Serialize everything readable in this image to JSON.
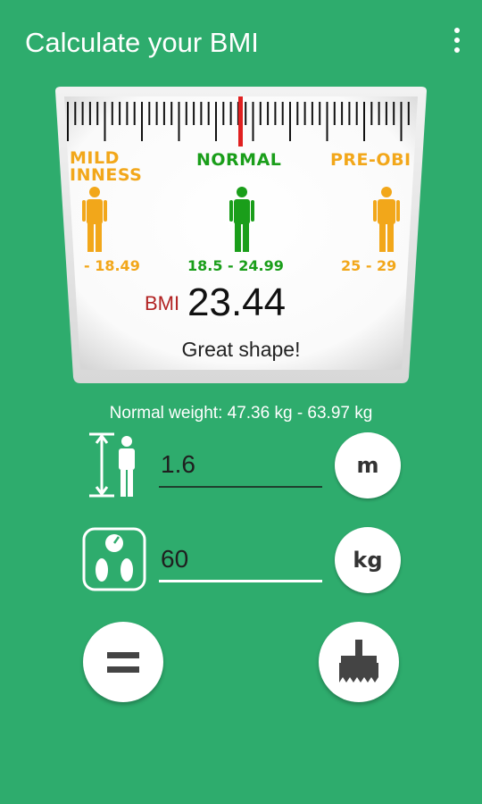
{
  "app_bar": {
    "title": "Calculate your BMI",
    "menu_icon": "overflow-menu-icon"
  },
  "scale": {
    "categories": [
      {
        "label_line1": "MILD",
        "label_line2": "INNESS",
        "range": "- 18.49",
        "color": "#f2a71a"
      },
      {
        "label_line1": "NORMAL",
        "label_line2": "",
        "range": "18.5 - 24.99",
        "color": "#1a9e1a"
      },
      {
        "label_line1": "PRE-OBI",
        "label_line2": "",
        "range": "25 - 29",
        "color": "#f2a71a"
      }
    ],
    "indicator_color": "#e02020",
    "bmi_prefix": "BMI",
    "bmi_value": "23.44",
    "status": "Great shape!"
  },
  "normal_weight": "Normal weight: 47.36 kg - 63.97 kg",
  "height": {
    "value": "1.6",
    "unit": "m",
    "icon": "height-person-icon"
  },
  "weight": {
    "value": "60",
    "unit": "kg",
    "icon": "bathroom-scale-icon"
  },
  "actions": {
    "calculate_icon": "equals-icon",
    "clear_icon": "brush-icon"
  },
  "colors": {
    "background": "#2eac6d",
    "warning": "#f2a71a",
    "normal": "#1a9e1a"
  }
}
